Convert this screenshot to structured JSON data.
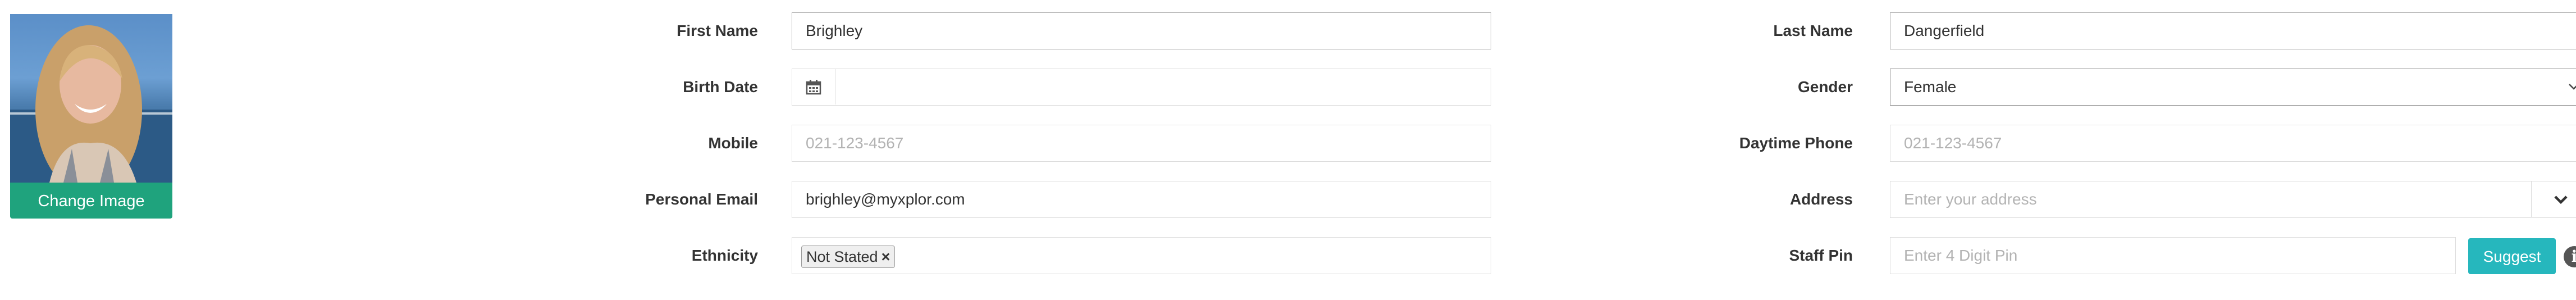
{
  "profile": {
    "change_image_label": "Change Image"
  },
  "fields": {
    "first_name": {
      "label": "First Name",
      "value": "Brighley"
    },
    "last_name": {
      "label": "Last Name",
      "value": "Dangerfield"
    },
    "birth_date": {
      "label": "Birth Date",
      "value": "",
      "icon": "calendar-icon"
    },
    "gender": {
      "label": "Gender",
      "value": "Female",
      "icon": "chevron-down-icon"
    },
    "mobile": {
      "label": "Mobile",
      "placeholder": "021-123-4567"
    },
    "daytime_phone": {
      "label": "Daytime Phone",
      "placeholder": "021-123-4567"
    },
    "personal_email": {
      "label": "Personal Email",
      "value": "brighley@myxplor.com"
    },
    "address": {
      "label": "Address",
      "placeholder": "Enter your address",
      "icon": "chevron-down-icon"
    },
    "ethnicity": {
      "label": "Ethnicity",
      "tag": "Not Stated",
      "remove_glyph": "×"
    },
    "staff_pin": {
      "label": "Staff Pin",
      "placeholder": "Enter 4 Digit Pin",
      "suggest_label": "Suggest",
      "info_glyph": "i"
    }
  },
  "colors": {
    "change_image_button": "#1fa37d",
    "suggest_button": "#26b7bd",
    "label_text": "#333333",
    "placeholder_text": "#b3b3b3"
  }
}
